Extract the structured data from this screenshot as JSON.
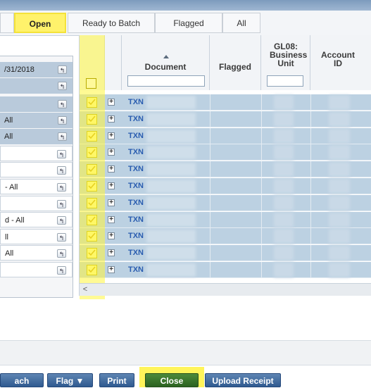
{
  "tabs": [
    {
      "label": "Open",
      "active": true
    },
    {
      "label": "Ready to Batch",
      "active": false
    },
    {
      "label": "Flagged",
      "active": false
    },
    {
      "label": "All",
      "active": false
    }
  ],
  "filters": [
    {
      "value": "/31/2018",
      "style": "shaded"
    },
    {
      "value": "",
      "style": "shaded"
    },
    {
      "value": "",
      "style": "shaded"
    },
    {
      "value": "All",
      "style": "shaded"
    },
    {
      "value": "All",
      "style": "shaded"
    },
    {
      "value": "",
      "style": "white"
    },
    {
      "value": "",
      "style": "white"
    },
    {
      "value": "- All",
      "style": "white"
    },
    {
      "value": "",
      "style": "white"
    },
    {
      "value": "d - All",
      "style": "white"
    },
    {
      "value": "ll",
      "style": "white"
    },
    {
      "value": "All",
      "style": "white"
    },
    {
      "value": "",
      "style": "white"
    }
  ],
  "grid": {
    "columns": {
      "document": "Document",
      "flagged": "Flagged",
      "gl08": "GL08: Business Unit",
      "account": "Account ID"
    },
    "row_prefix": "TXN",
    "row_count": 11,
    "scroll_left": "<"
  },
  "toolbar": {
    "batch": "ach",
    "flag": "Flag ▼",
    "print": "Print",
    "close": "Close",
    "upload": "Upload Receipt"
  },
  "colors": {
    "highlight": "#fff45a",
    "row": "#bcd1e2",
    "link": "#2a5db0"
  }
}
